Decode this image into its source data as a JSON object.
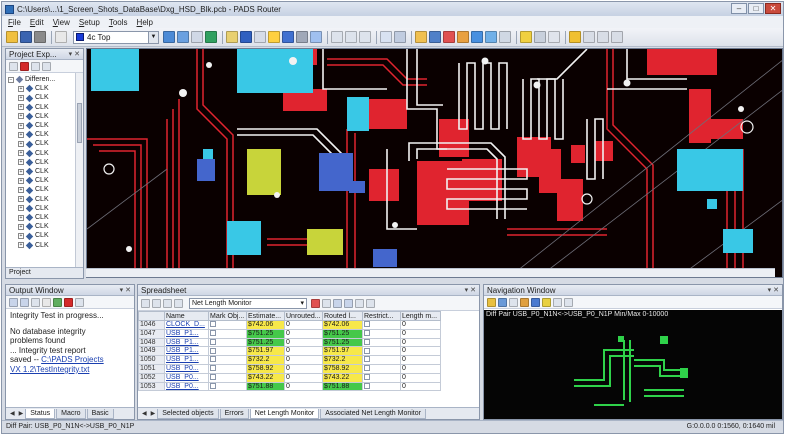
{
  "window": {
    "title": "C:\\Users\\...\\1_Screen_Shots_DataBase\\Dxg_HSD_Blk.pcb - PADS Router",
    "minimize": "–",
    "maximize": "□",
    "close": "✕"
  },
  "menu": [
    "File",
    "Edit",
    "View",
    "Setup",
    "Tools",
    "Help"
  ],
  "toolbar": {
    "layer_select": "4c Top",
    "layer_color": "#1a3cd8"
  },
  "project_explorer": {
    "title": "Project Exp...",
    "pin": "▾ ✕",
    "tree_root": "Differen...",
    "tree_items": [
      "CLK",
      "CLK",
      "CLK",
      "CLK",
      "CLK",
      "CLK",
      "CLK",
      "CLK",
      "CLK",
      "CLK",
      "CLK",
      "CLK",
      "CLK",
      "CLK",
      "CLK",
      "CLK",
      "CLK",
      "CLK"
    ],
    "tab": "Project"
  },
  "output_window": {
    "title": "Output Window",
    "pin": "▾ ✕",
    "lines": [
      "Integrity Test in progress...",
      "",
      "No database integrity",
      "problems found",
      "... Integrity test report",
      "saved -- "
    ],
    "link_1": "C:\\PADS Projects",
    "link_2": "VX 1.2\\TestIntegrity.txt",
    "tabs": [
      "Status",
      "Macro",
      "Basic"
    ]
  },
  "spreadsheet": {
    "title": "Spreadsheet",
    "pin": "▾ ✕",
    "monitor_select": "Net Length Monitor",
    "columns": [
      "",
      "Name",
      "Mark Obj...",
      "Estimate...",
      "Unrouted...",
      "Routed l...",
      "Restrict...",
      "Length m..."
    ],
    "rows": [
      {
        "id": "1046",
        "name": "CLOCK_D...",
        "estimate": "$742.06",
        "unrouted": "0",
        "routed": "$742.06",
        "est_green": false,
        "rtd_green": false,
        "length": "0"
      },
      {
        "id": "1047",
        "name": "USB_P1...",
        "estimate": "$751.25",
        "unrouted": "0",
        "routed": "$751.25",
        "est_green": true,
        "rtd_green": true,
        "length": "0"
      },
      {
        "id": "1048",
        "name": "USB_P1...",
        "estimate": "$751.25",
        "unrouted": "0",
        "routed": "$751.25",
        "est_green": true,
        "rtd_green": true,
        "length": "0"
      },
      {
        "id": "1049",
        "name": "USB_P1...",
        "estimate": "$751.97",
        "unrouted": "0",
        "routed": "$751.97",
        "est_green": false,
        "rtd_green": false,
        "length": "0"
      },
      {
        "id": "1050",
        "name": "USB_P1...",
        "estimate": "$732.2",
        "unrouted": "0",
        "routed": "$732.2",
        "est_green": false,
        "rtd_green": false,
        "length": "0"
      },
      {
        "id": "1051",
        "name": "USB_P0...",
        "estimate": "$758.92",
        "unrouted": "0",
        "routed": "$758.92",
        "est_green": false,
        "rtd_green": false,
        "length": "0"
      },
      {
        "id": "1052",
        "name": "USB_P0...",
        "estimate": "$743.22",
        "unrouted": "0",
        "routed": "$743.22",
        "est_green": false,
        "rtd_green": false,
        "length": "0"
      },
      {
        "id": "1053",
        "name": "USB_P0...",
        "estimate": "$751.88",
        "unrouted": "0",
        "routed": "$751.88",
        "est_green": true,
        "rtd_green": true,
        "length": "0"
      }
    ],
    "tabs": [
      "Selected objects",
      "Errors",
      "Net Length Monitor",
      "Associated Net Length Monitor"
    ]
  },
  "navigation_window": {
    "title": "Navigation Window",
    "pin": "▾ ✕",
    "caption": "Diff Pair USB_P0_N1N<->USB_P0_N1P Min/Max 0-10000"
  },
  "status": {
    "left": "Diff Pair: USB_P0_N1N<->USB_P0_N1P",
    "right": "G:0.0.0.0  0:1560,  0:1640  mil"
  },
  "colors": {
    "board_bg": "#0a0000",
    "trace_red": "#e0242f",
    "trace_white": "#f2f2f2",
    "pad_cyan": "#39c8e6",
    "pad_yellow": "#c8d43a",
    "via_blue": "#4466cc",
    "nav_green": "#2fd24a"
  }
}
